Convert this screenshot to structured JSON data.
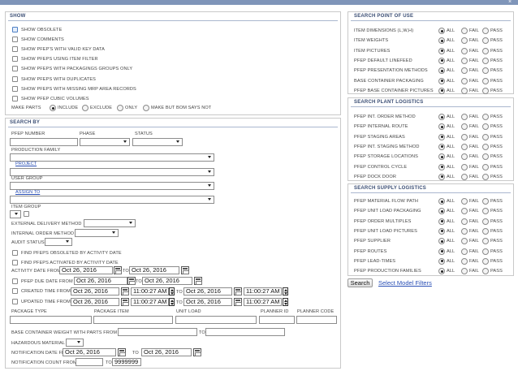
{
  "window": {
    "close_glyph": "×"
  },
  "show": {
    "title": "SHOW",
    "checkboxes": [
      "SHOW OBSOLETE",
      "SHOW COMMENTS",
      "SHOW PFEP'S WITH VALID KEY DATA",
      "SHOW PFEPS USING ITEM FILTER",
      "SHOW PFEPS WITH PACKAGINGS GROUPS ONLY",
      "SHOW PFEPS WITH DUPLICATES",
      "SHOW PFEPS WITH MISSING MRP AREA RECORDS",
      "SHOW PFEP CUBIC VOLUMES"
    ],
    "make_parts_label": "MAKE PARTS",
    "make_parts_options": [
      "INCLUDE",
      "EXCLUDE",
      "ONLY",
      "MAKE BUT BOM SAYS NOT"
    ],
    "make_parts_selected": "INCLUDE"
  },
  "search_by": {
    "title": "SEARCH BY",
    "pfep_number_label": "PFEP NUMBER",
    "phase_label": "PHASE",
    "status_label": "STATUS",
    "production_family_label": "PRODUCTION FAMILY",
    "project_link": "PROJECT",
    "user_group_label": "USER GROUP",
    "assign_to_link": "ASSIGN TO",
    "item_group_label": "ITEM GROUP",
    "external_delivery_label": "EXTERNAL DELIVERY METHOD",
    "internal_order_label": "INTERNAL ORDER METHOD",
    "audit_status_label": "AUDIT STATUS",
    "find_obsoleted_label": "FIND PFEPS OBSOLETED BY ACTIVITY DATE",
    "find_activated_label": "FIND PFEPS ACTIVATED BY ACTIVITY DATE",
    "activity_date_label": "ACTIVITY DATE FROM",
    "activity_date_from": "Oct 26, 2016",
    "activity_date_to": "Oct 26, 2016",
    "to_label": "TO",
    "pfep_due_date_label": "PFEP DUE DATE FROM",
    "pfep_due_from": "Oct 26, 2016",
    "pfep_due_to": "Oct 26, 2016",
    "created_time_label": "CREATED TIME FROM",
    "created_date_from": "Oct 26, 2016",
    "created_time_from": "11:00:27 AM",
    "created_date_to": "Oct 26, 2016",
    "created_time_to": "11:00:27 AM",
    "updated_time_label": "UPDATED TIME FROM",
    "updated_date_from": "Oct 26, 2016",
    "updated_time_from": "11:00:27 AM",
    "updated_date_to": "Oct 26, 2016",
    "updated_time_to": "11:00:27 AM",
    "package_type_label": "PACKAGE TYPE",
    "package_item_label": "PACKAGE ITEM",
    "unit_load_label": "UNIT LOAD",
    "planner_id_label": "PLANNER ID",
    "planner_code_label": "PLANNER CODE",
    "base_container_weight_label": "BASE CONTAINER WEIGHT WITH PARTS FROM",
    "hazardous_material_label": "HAZARDOUS MATERIAL",
    "notification_date_label": "NOTIFICATION DATE FROM",
    "notification_date_from": "Oct 26, 2016",
    "notification_date_to": "Oct 26, 2016",
    "notification_count_label": "NOTIFICATION COUNT FROM",
    "notification_count_to": "9999999"
  },
  "search_point_of_use": {
    "title": "SEARCH POINT OF USE",
    "rows": [
      "ITEM DIMENSIONS (L,W,H)",
      "ITEM WEIGHTS",
      "ITEM PICTURES",
      "PFEP DEFAULT LINEFEED",
      "PFEP PRESENTATION METHODS",
      "BASE CONTAINER PACKAGING",
      "PFEP BASE CONTAINER PICTURES"
    ]
  },
  "search_plant_logistics": {
    "title": "SEARCH PLANT LOGISTICS",
    "rows": [
      "PFEP INT. ORDER METHOD",
      "PFEP INTERNAL ROUTE",
      "PFEP STAGING AREAS",
      "PFEP INT. STAGING METHOD",
      "PFEP STORAGE LOCATIONS",
      "PFEP CONTROL CYCLE",
      "PFEP DOCK DOOR"
    ]
  },
  "search_supply_logistics": {
    "title": "SEARCH SUPPLY LOGISTICS",
    "rows": [
      "PFEP MATERIAL FLOW PATH",
      "PFEP UNIT LOAD PACKAGING",
      "PFEP ORDER MULTIPLES",
      "PFEP UNIT LOAD PICTURES",
      "PFEP SUPPLIER",
      "PFEP ROUTES",
      "PFEP LEAD-TIMES",
      "PFEP PRODUCTION FAMILIES"
    ]
  },
  "radio_options": [
    "ALL",
    "FAIL",
    "PASS"
  ],
  "radio_selected": "ALL",
  "search_button": "Search",
  "select_model_filters": "Select Model Filters",
  "colors": {
    "header_bar": "#7f95b9",
    "section_title": "#3b4e74",
    "link": "#2a4fb5"
  }
}
